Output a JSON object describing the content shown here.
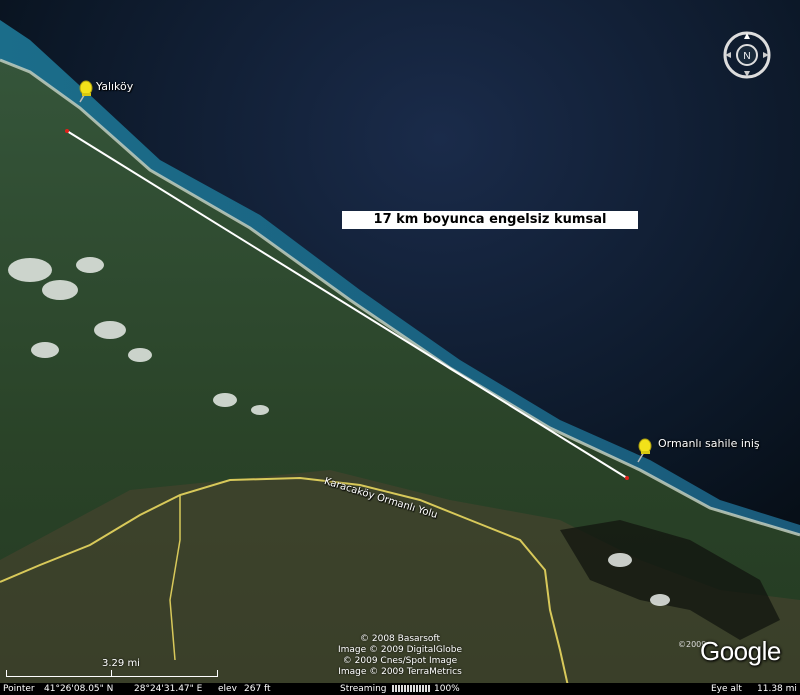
{
  "map": {
    "pins": [
      {
        "label": "Yalıköy"
      },
      {
        "label": "Ormanlı sahile iniş"
      }
    ],
    "annotation": "17 km boyunca engelsiz kumsal",
    "road_label": "Karacaköy Ormanlı Yolu",
    "pin_color": "#f2e21a",
    "path_color": "#ffffff",
    "road_color": "#d8c95a",
    "sea_color": "#0b1a2e",
    "land_color": "#2c4a2a"
  },
  "compass": {
    "north_label": "N"
  },
  "credits": [
    "© 2008 Basarsoft",
    "Image © 2009 DigitalGlobe",
    "© 2009 Cnes/Spot Image",
    "Image © 2009 TerraMetrics"
  ],
  "logo": {
    "text": "Google",
    "copyright": "©2009"
  },
  "scale": {
    "label": "3.29 mi"
  },
  "status": {
    "pointer_label": "Pointer",
    "lat": "41°26'08.05\" N",
    "lon": "28°24'31.47\" E",
    "elev_label": "elev",
    "elev_value": "267 ft",
    "streaming_label": "Streaming",
    "streaming_percent": "100%",
    "eye_alt_label": "Eye alt",
    "eye_alt_value": "11.38 mi"
  }
}
